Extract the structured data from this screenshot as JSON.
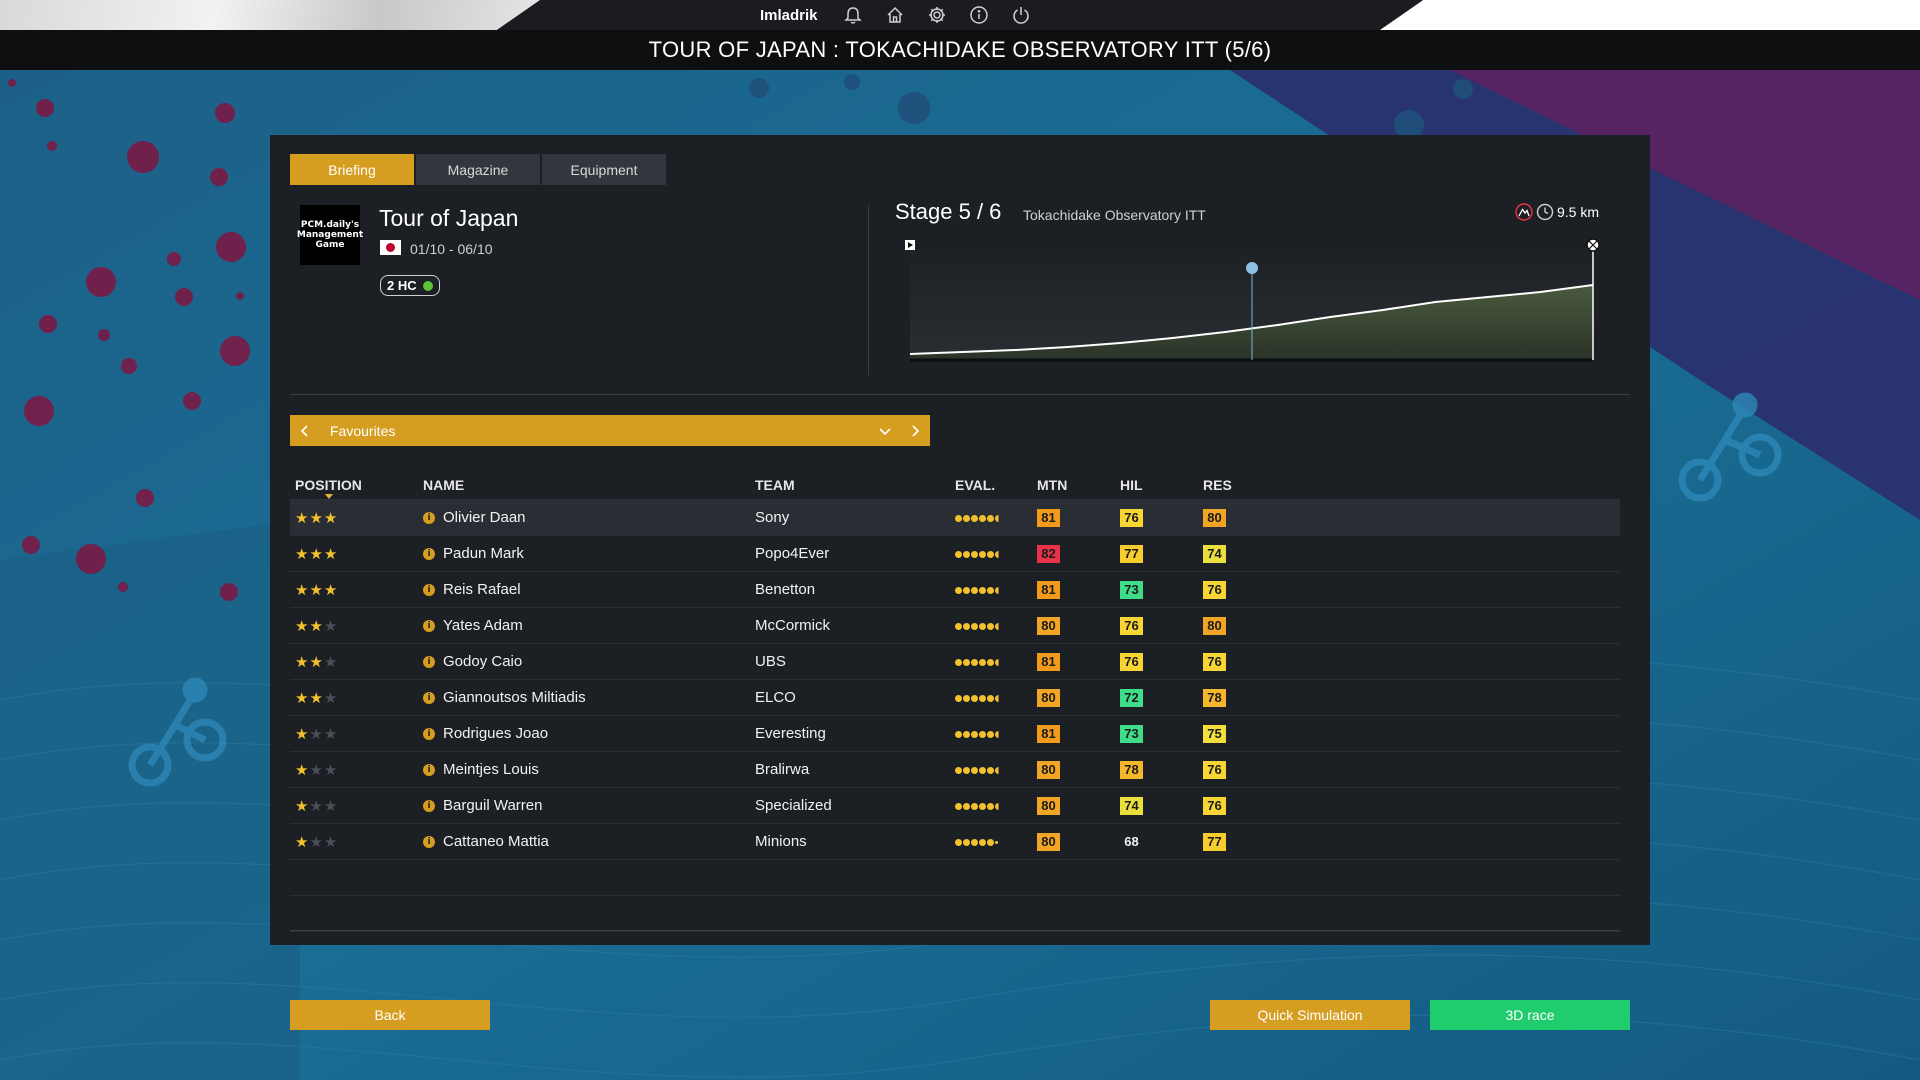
{
  "topbar": {
    "username": "Imladrik",
    "icons": [
      "bell-icon",
      "home-icon",
      "gear-icon",
      "info-icon",
      "power-icon"
    ]
  },
  "title": "TOUR OF JAPAN : TOKACHIDAKE OBSERVATORY ITT (5/6)",
  "tabs": [
    {
      "label": "Briefing",
      "active": true
    },
    {
      "label": "Magazine",
      "active": false
    },
    {
      "label": "Equipment",
      "active": false
    }
  ],
  "race": {
    "logo_text": "PCM.daily's Management Game",
    "name": "Tour of Japan",
    "dates": "01/10 - 06/10",
    "class": "2 HC",
    "flag": "japan-flag-icon"
  },
  "stage": {
    "title": "Stage 5 / 6",
    "name": "Tokachidake Observatory ITT",
    "distance": "9.5 km",
    "profile_elevation": [
      0.06,
      0.08,
      0.1,
      0.13,
      0.17,
      0.22,
      0.28,
      0.35,
      0.43,
      0.5,
      0.58,
      0.63,
      0.68,
      0.75
    ]
  },
  "favourites": {
    "label": "Favourites"
  },
  "table": {
    "headers": {
      "position": "POSITION",
      "name": "NAME",
      "team": "TEAM",
      "eval": "EVAL.",
      "mtn": "MTN",
      "hil": "HIL",
      "res": "RES"
    },
    "rows": [
      {
        "stars": 3,
        "name": "Olivier Daan",
        "team": "Sony",
        "eval": 5.5,
        "mtn": "81",
        "hil": "76",
        "res": "80"
      },
      {
        "stars": 3,
        "name": "Padun Mark",
        "team": "Popo4Ever",
        "eval": 5.5,
        "mtn": "82",
        "hil": "77",
        "res": "74"
      },
      {
        "stars": 3,
        "name": "Reis Rafael",
        "team": "Benetton",
        "eval": 5.5,
        "mtn": "81",
        "hil": "73",
        "res": "76"
      },
      {
        "stars": 2,
        "name": "Yates Adam",
        "team": "McCormick",
        "eval": 5.5,
        "mtn": "80",
        "hil": "76",
        "res": "80"
      },
      {
        "stars": 2,
        "name": "Godoy Caio",
        "team": "UBS",
        "eval": 5.5,
        "mtn": "81",
        "hil": "76",
        "res": "76"
      },
      {
        "stars": 2,
        "name": "Giannoutsos Miltiadis",
        "team": "ELCO",
        "eval": 5.5,
        "mtn": "80",
        "hil": "72",
        "res": "78"
      },
      {
        "stars": 1,
        "name": "Rodrigues Joao",
        "team": "Everesting",
        "eval": 5.5,
        "mtn": "81",
        "hil": "73",
        "res": "75"
      },
      {
        "stars": 1,
        "name": "Meintjes Louis",
        "team": "Bralirwa",
        "eval": 5.5,
        "mtn": "80",
        "hil": "78",
        "res": "76"
      },
      {
        "stars": 1,
        "name": "Barguil Warren",
        "team": "Specialized",
        "eval": 5.5,
        "mtn": "80",
        "hil": "74",
        "res": "76"
      },
      {
        "stars": 1,
        "name": "Cattaneo Mattia",
        "team": "Minions",
        "eval": 5,
        "mtn": "80",
        "hil": "68",
        "res": "77"
      }
    ]
  },
  "buttons": {
    "back": "Back",
    "quick": "Quick Simulation",
    "race3d": "3D race"
  },
  "colors": {
    "accent": "#d69e20",
    "green_button": "#1fcc6e",
    "stat_82": "#e8324a",
    "stat_81": "#f29a1a",
    "stat_80": "#f2a524",
    "stat_78": "#f5b62c",
    "stat_77": "#f7cd2e",
    "stat_76": "#f7d633",
    "stat_75": "#f2df3a",
    "stat_74": "#eadf3c",
    "stat_73": "#3fdc8a",
    "stat_72": "#3fdc8a"
  }
}
